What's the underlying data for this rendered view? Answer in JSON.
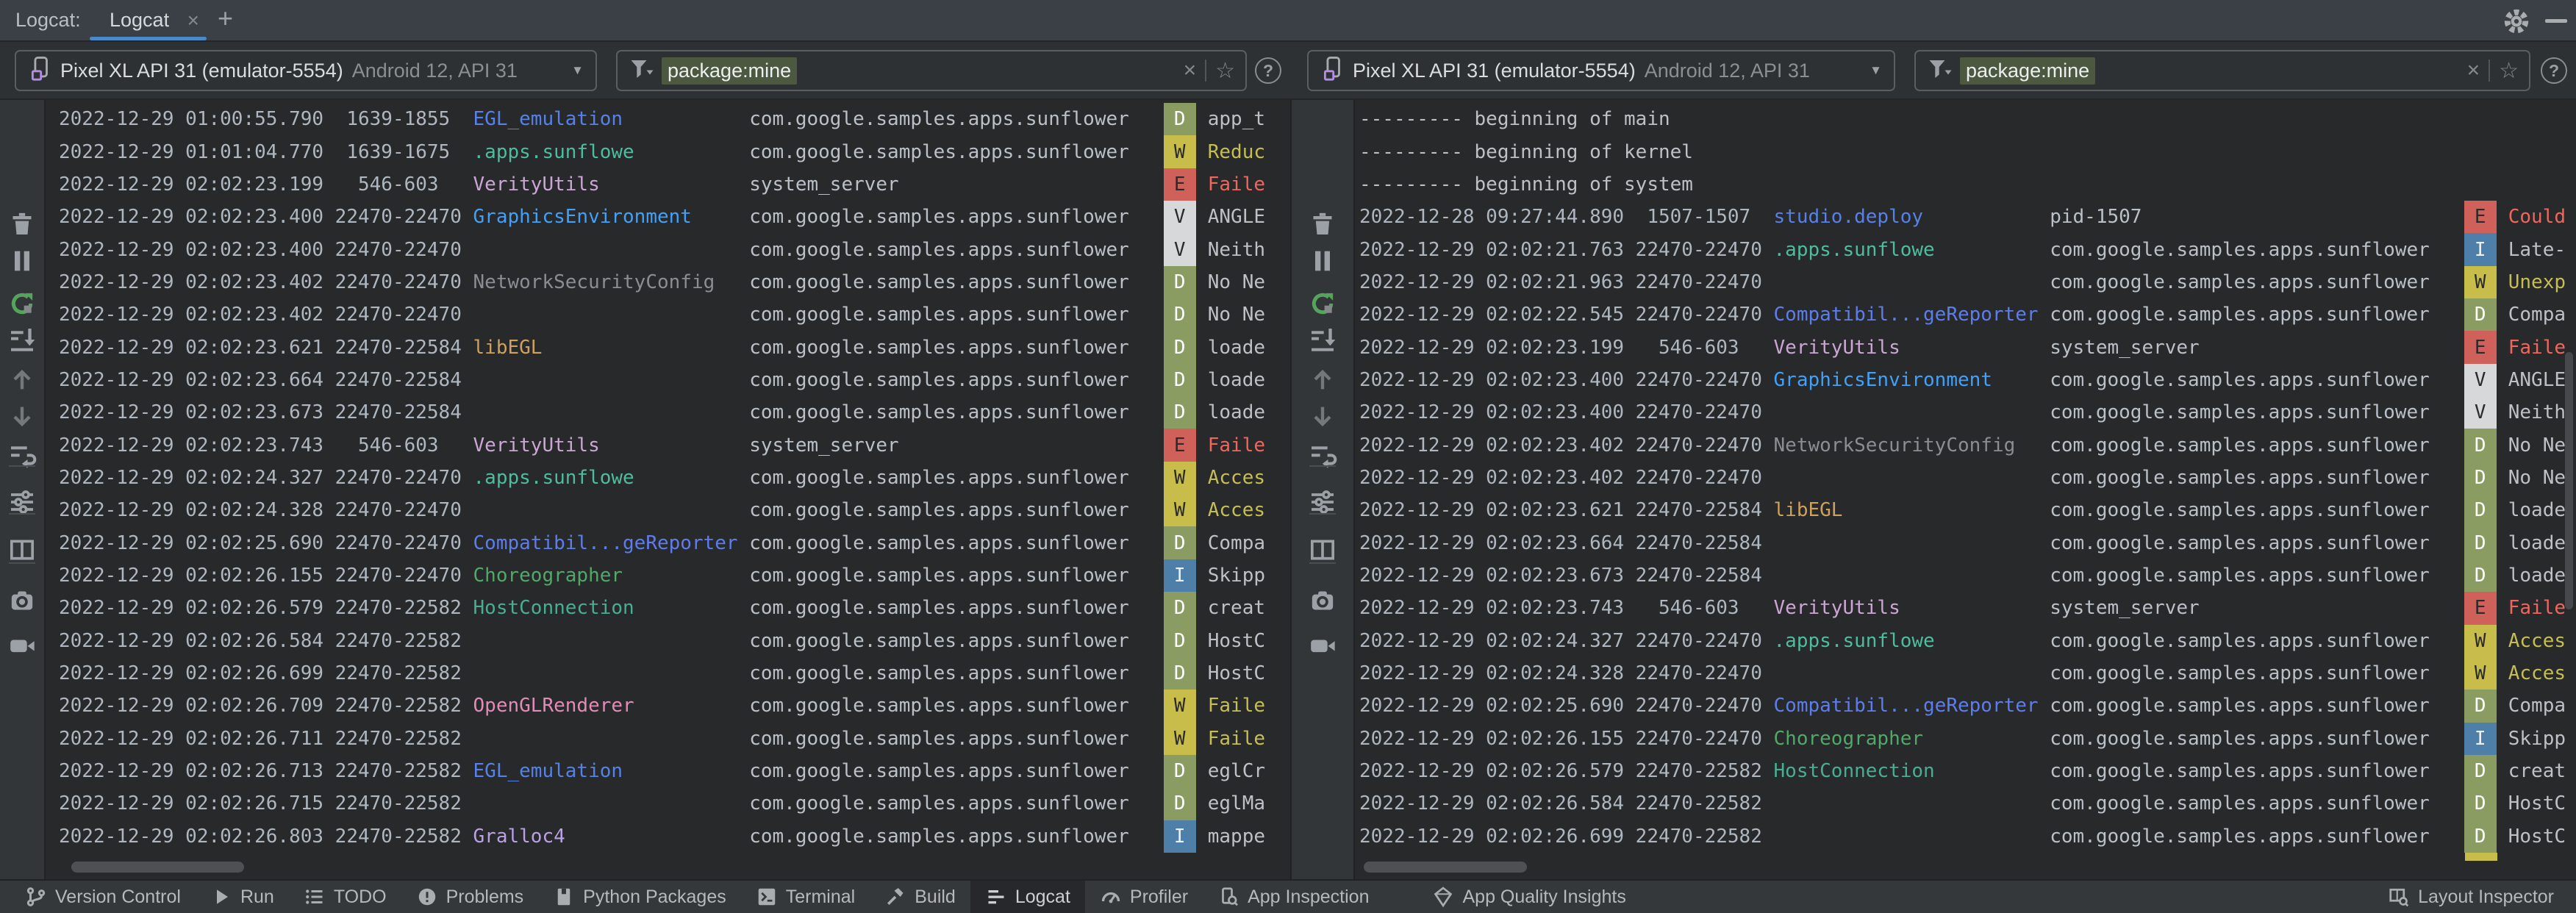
{
  "window": {
    "panel_label": "Logcat:",
    "tab_label": "Logcat",
    "tab_close": "×",
    "add_tab": "+"
  },
  "toolbar": {
    "device": {
      "name": "Pixel XL API 31 (emulator-5554)",
      "details": "Android 12, API 31",
      "arrow": "▼"
    },
    "filter": {
      "value": "package:mine",
      "clear": "×",
      "favorite": "☆",
      "help": "?"
    }
  },
  "side_toolbar": {
    "items": [
      "trash",
      "pause",
      "restart",
      "scroll-to-end",
      "previous-occurrence",
      "next-occurrence",
      "soft-wrap",
      "sep",
      "format-options",
      "sep",
      "split-panel",
      "sep",
      "screenshot",
      "screen-record"
    ]
  },
  "colors": {
    "accent_tab_underline": "#4A88C7",
    "filter_highlight": "#4C583F",
    "tags": {
      "blue": "#5581E8",
      "teal": "#4EBD9E",
      "lavender": "#CBA6D4",
      "azure": "#41A0F8",
      "gray": "#8A8E92",
      "orange": "#CEA15D",
      "indigo": "#5D7DEB",
      "green": "#52A869",
      "teal2": "#48AE92",
      "pink": "#E08BB8",
      "lilac": "#B9A1E3"
    },
    "levels": {
      "D": {
        "bg": "#8B9C63",
        "fg": "#FFFFFF",
        "msg": "#BDC1C5"
      },
      "W": {
        "bg": "#C8BC4B",
        "fg": "#2B2B2B",
        "msg": "#C6BE52"
      },
      "E": {
        "bg": "#D0605A",
        "fg": "#2B2B2B",
        "msg": "#F0665C"
      },
      "V": {
        "bg": "#D6D8DA",
        "fg": "#2B2B2B",
        "msg": "#BDC1C5"
      },
      "I": {
        "bg": "#4E7FA8",
        "fg": "#EDEFF1",
        "msg": "#BDC1C5"
      }
    }
  },
  "left_pane": {
    "rows": [
      {
        "ts": "2022-12-29 01:00:55.790",
        "pid": "1639-1855",
        "tag": "EGL_emulation",
        "tag_color": "blue",
        "pkg": "com.google.samples.apps.sunflower",
        "level": "D",
        "msg": "app_t"
      },
      {
        "ts": "2022-12-29 01:01:04.770",
        "pid": "1639-1675",
        "tag": ".apps.sunflowe",
        "tag_color": "teal",
        "pkg": "com.google.samples.apps.sunflower",
        "level": "W",
        "msg": "Reduc"
      },
      {
        "ts": "2022-12-29 02:02:23.199",
        "pid": "546-603",
        "tag": "VerityUtils",
        "tag_color": "lavender",
        "pkg": "system_server",
        "level": "E",
        "msg": "Faile"
      },
      {
        "ts": "2022-12-29 02:02:23.400",
        "pid": "22470-22470",
        "tag": "GraphicsEnvironment",
        "tag_color": "azure",
        "pkg": "com.google.samples.apps.sunflower",
        "level": "V",
        "msg": "ANGLE"
      },
      {
        "ts": "2022-12-29 02:02:23.400",
        "pid": "22470-22470",
        "tag": "",
        "tag_color": "",
        "pkg": "com.google.samples.apps.sunflower",
        "level": "V",
        "msg": "Neith"
      },
      {
        "ts": "2022-12-29 02:02:23.402",
        "pid": "22470-22470",
        "tag": "NetworkSecurityConfig",
        "tag_color": "gray",
        "pkg": "com.google.samples.apps.sunflower",
        "level": "D",
        "msg": "No Ne"
      },
      {
        "ts": "2022-12-29 02:02:23.402",
        "pid": "22470-22470",
        "tag": "",
        "tag_color": "",
        "pkg": "com.google.samples.apps.sunflower",
        "level": "D",
        "msg": "No Ne"
      },
      {
        "ts": "2022-12-29 02:02:23.621",
        "pid": "22470-22584",
        "tag": "libEGL",
        "tag_color": "orange",
        "pkg": "com.google.samples.apps.sunflower",
        "level": "D",
        "msg": "loade"
      },
      {
        "ts": "2022-12-29 02:02:23.664",
        "pid": "22470-22584",
        "tag": "",
        "tag_color": "",
        "pkg": "com.google.samples.apps.sunflower",
        "level": "D",
        "msg": "loade"
      },
      {
        "ts": "2022-12-29 02:02:23.673",
        "pid": "22470-22584",
        "tag": "",
        "tag_color": "",
        "pkg": "com.google.samples.apps.sunflower",
        "level": "D",
        "msg": "loade"
      },
      {
        "ts": "2022-12-29 02:02:23.743",
        "pid": "546-603",
        "tag": "VerityUtils",
        "tag_color": "lavender",
        "pkg": "system_server",
        "level": "E",
        "msg": "Faile"
      },
      {
        "ts": "2022-12-29 02:02:24.327",
        "pid": "22470-22470",
        "tag": ".apps.sunflowe",
        "tag_color": "teal",
        "pkg": "com.google.samples.apps.sunflower",
        "level": "W",
        "msg": "Acces"
      },
      {
        "ts": "2022-12-29 02:02:24.328",
        "pid": "22470-22470",
        "tag": "",
        "tag_color": "",
        "pkg": "com.google.samples.apps.sunflower",
        "level": "W",
        "msg": "Acces"
      },
      {
        "ts": "2022-12-29 02:02:25.690",
        "pid": "22470-22470",
        "tag": "Compatibil...geReporter",
        "tag_color": "indigo",
        "pkg": "com.google.samples.apps.sunflower",
        "level": "D",
        "msg": "Compa"
      },
      {
        "ts": "2022-12-29 02:02:26.155",
        "pid": "22470-22470",
        "tag": "Choreographer",
        "tag_color": "green",
        "pkg": "com.google.samples.apps.sunflower",
        "level": "I",
        "msg": "Skipp"
      },
      {
        "ts": "2022-12-29 02:02:26.579",
        "pid": "22470-22582",
        "tag": "HostConnection",
        "tag_color": "teal2",
        "pkg": "com.google.samples.apps.sunflower",
        "level": "D",
        "msg": "creat"
      },
      {
        "ts": "2022-12-29 02:02:26.584",
        "pid": "22470-22582",
        "tag": "",
        "tag_color": "",
        "pkg": "com.google.samples.apps.sunflower",
        "level": "D",
        "msg": "HostC"
      },
      {
        "ts": "2022-12-29 02:02:26.699",
        "pid": "22470-22582",
        "tag": "",
        "tag_color": "",
        "pkg": "com.google.samples.apps.sunflower",
        "level": "D",
        "msg": "HostC"
      },
      {
        "ts": "2022-12-29 02:02:26.709",
        "pid": "22470-22582",
        "tag": "OpenGLRenderer",
        "tag_color": "pink",
        "pkg": "com.google.samples.apps.sunflower",
        "level": "W",
        "msg": "Faile"
      },
      {
        "ts": "2022-12-29 02:02:26.711",
        "pid": "22470-22582",
        "tag": "",
        "tag_color": "",
        "pkg": "com.google.samples.apps.sunflower",
        "level": "W",
        "msg": "Faile"
      },
      {
        "ts": "2022-12-29 02:02:26.713",
        "pid": "22470-22582",
        "tag": "EGL_emulation",
        "tag_color": "blue",
        "pkg": "com.google.samples.apps.sunflower",
        "level": "D",
        "msg": "eglCr"
      },
      {
        "ts": "2022-12-29 02:02:26.715",
        "pid": "22470-22582",
        "tag": "",
        "tag_color": "",
        "pkg": "com.google.samples.apps.sunflower",
        "level": "D",
        "msg": "eglMa"
      },
      {
        "ts": "2022-12-29 02:02:26.803",
        "pid": "22470-22582",
        "tag": "Gralloc4",
        "tag_color": "lilac",
        "pkg": "com.google.samples.apps.sunflower",
        "level": "I",
        "msg": "mappe"
      }
    ]
  },
  "right_pane": {
    "rows": [
      {
        "banner": "--------- beginning of main"
      },
      {
        "banner": "--------- beginning of kernel"
      },
      {
        "banner": "--------- beginning of system"
      },
      {
        "ts": "2022-12-28 09:27:44.890",
        "pid": "1507-1507",
        "tag": "studio.deploy",
        "tag_color": "blue",
        "pkg": "pid-1507",
        "level": "E",
        "msg": "Could"
      },
      {
        "ts": "2022-12-29 02:02:21.763",
        "pid": "22470-22470",
        "tag": ".apps.sunflowe",
        "tag_color": "teal",
        "pkg": "com.google.samples.apps.sunflower",
        "level": "I",
        "msg": "Late-"
      },
      {
        "ts": "2022-12-29 02:02:21.963",
        "pid": "22470-22470",
        "tag": "",
        "tag_color": "",
        "pkg": "com.google.samples.apps.sunflower",
        "level": "W",
        "msg": "Unexp"
      },
      {
        "ts": "2022-12-29 02:02:22.545",
        "pid": "22470-22470",
        "tag": "Compatibil...geReporter",
        "tag_color": "indigo",
        "pkg": "com.google.samples.apps.sunflower",
        "level": "D",
        "msg": "Compa"
      },
      {
        "ts": "2022-12-29 02:02:23.199",
        "pid": "546-603",
        "tag": "VerityUtils",
        "tag_color": "lavender",
        "pkg": "system_server",
        "level": "E",
        "msg": "Faile"
      },
      {
        "ts": "2022-12-29 02:02:23.400",
        "pid": "22470-22470",
        "tag": "GraphicsEnvironment",
        "tag_color": "azure",
        "pkg": "com.google.samples.apps.sunflower",
        "level": "V",
        "msg": "ANGLE"
      },
      {
        "ts": "2022-12-29 02:02:23.400",
        "pid": "22470-22470",
        "tag": "",
        "tag_color": "",
        "pkg": "com.google.samples.apps.sunflower",
        "level": "V",
        "msg": "Neith"
      },
      {
        "ts": "2022-12-29 02:02:23.402",
        "pid": "22470-22470",
        "tag": "NetworkSecurityConfig",
        "tag_color": "gray",
        "pkg": "com.google.samples.apps.sunflower",
        "level": "D",
        "msg": "No Ne"
      },
      {
        "ts": "2022-12-29 02:02:23.402",
        "pid": "22470-22470",
        "tag": "",
        "tag_color": "",
        "pkg": "com.google.samples.apps.sunflower",
        "level": "D",
        "msg": "No Ne"
      },
      {
        "ts": "2022-12-29 02:02:23.621",
        "pid": "22470-22584",
        "tag": "libEGL",
        "tag_color": "orange",
        "pkg": "com.google.samples.apps.sunflower",
        "level": "D",
        "msg": "loade"
      },
      {
        "ts": "2022-12-29 02:02:23.664",
        "pid": "22470-22584",
        "tag": "",
        "tag_color": "",
        "pkg": "com.google.samples.apps.sunflower",
        "level": "D",
        "msg": "loade"
      },
      {
        "ts": "2022-12-29 02:02:23.673",
        "pid": "22470-22584",
        "tag": "",
        "tag_color": "",
        "pkg": "com.google.samples.apps.sunflower",
        "level": "D",
        "msg": "loade"
      },
      {
        "ts": "2022-12-29 02:02:23.743",
        "pid": "546-603",
        "tag": "VerityUtils",
        "tag_color": "lavender",
        "pkg": "system_server",
        "level": "E",
        "msg": "Faile"
      },
      {
        "ts": "2022-12-29 02:02:24.327",
        "pid": "22470-22470",
        "tag": ".apps.sunflowe",
        "tag_color": "teal",
        "pkg": "com.google.samples.apps.sunflower",
        "level": "W",
        "msg": "Acces"
      },
      {
        "ts": "2022-12-29 02:02:24.328",
        "pid": "22470-22470",
        "tag": "",
        "tag_color": "",
        "pkg": "com.google.samples.apps.sunflower",
        "level": "W",
        "msg": "Acces"
      },
      {
        "ts": "2022-12-29 02:02:25.690",
        "pid": "22470-22470",
        "tag": "Compatibil...geReporter",
        "tag_color": "indigo",
        "pkg": "com.google.samples.apps.sunflower",
        "level": "D",
        "msg": "Compa"
      },
      {
        "ts": "2022-12-29 02:02:26.155",
        "pid": "22470-22470",
        "tag": "Choreographer",
        "tag_color": "green",
        "pkg": "com.google.samples.apps.sunflower",
        "level": "I",
        "msg": "Skipp"
      },
      {
        "ts": "2022-12-29 02:02:26.579",
        "pid": "22470-22582",
        "tag": "HostConnection",
        "tag_color": "teal2",
        "pkg": "com.google.samples.apps.sunflower",
        "level": "D",
        "msg": "creat"
      },
      {
        "ts": "2022-12-29 02:02:26.584",
        "pid": "22470-22582",
        "tag": "",
        "tag_color": "",
        "pkg": "com.google.samples.apps.sunflower",
        "level": "D",
        "msg": "HostC"
      },
      {
        "ts": "2022-12-29 02:02:26.699",
        "pid": "22470-22582",
        "tag": "",
        "tag_color": "",
        "pkg": "com.google.samples.apps.sunflower",
        "level": "D",
        "msg": "HostC"
      }
    ],
    "partial_next_level": "W"
  },
  "status_bar": {
    "left_items": [
      {
        "icon": "version-control-icon",
        "label": "Version Control"
      },
      {
        "icon": "run-icon",
        "label": "Run"
      },
      {
        "icon": "todo-icon",
        "label": "TODO"
      },
      {
        "icon": "problems-icon",
        "label": "Problems"
      },
      {
        "icon": "python-packages-icon",
        "label": "Python Packages"
      },
      {
        "icon": "terminal-icon",
        "label": "Terminal"
      },
      {
        "icon": "build-icon",
        "label": "Build"
      },
      {
        "icon": "logcat-icon",
        "label": "Logcat",
        "active": true
      },
      {
        "icon": "profiler-icon",
        "label": "Profiler"
      },
      {
        "icon": "app-inspection-icon",
        "label": "App Inspection"
      },
      {
        "icon": "app-quality-insights-icon",
        "label": "App Quality Insights"
      }
    ],
    "right_items": [
      {
        "icon": "layout-inspector-icon",
        "label": "Layout Inspector"
      }
    ]
  }
}
